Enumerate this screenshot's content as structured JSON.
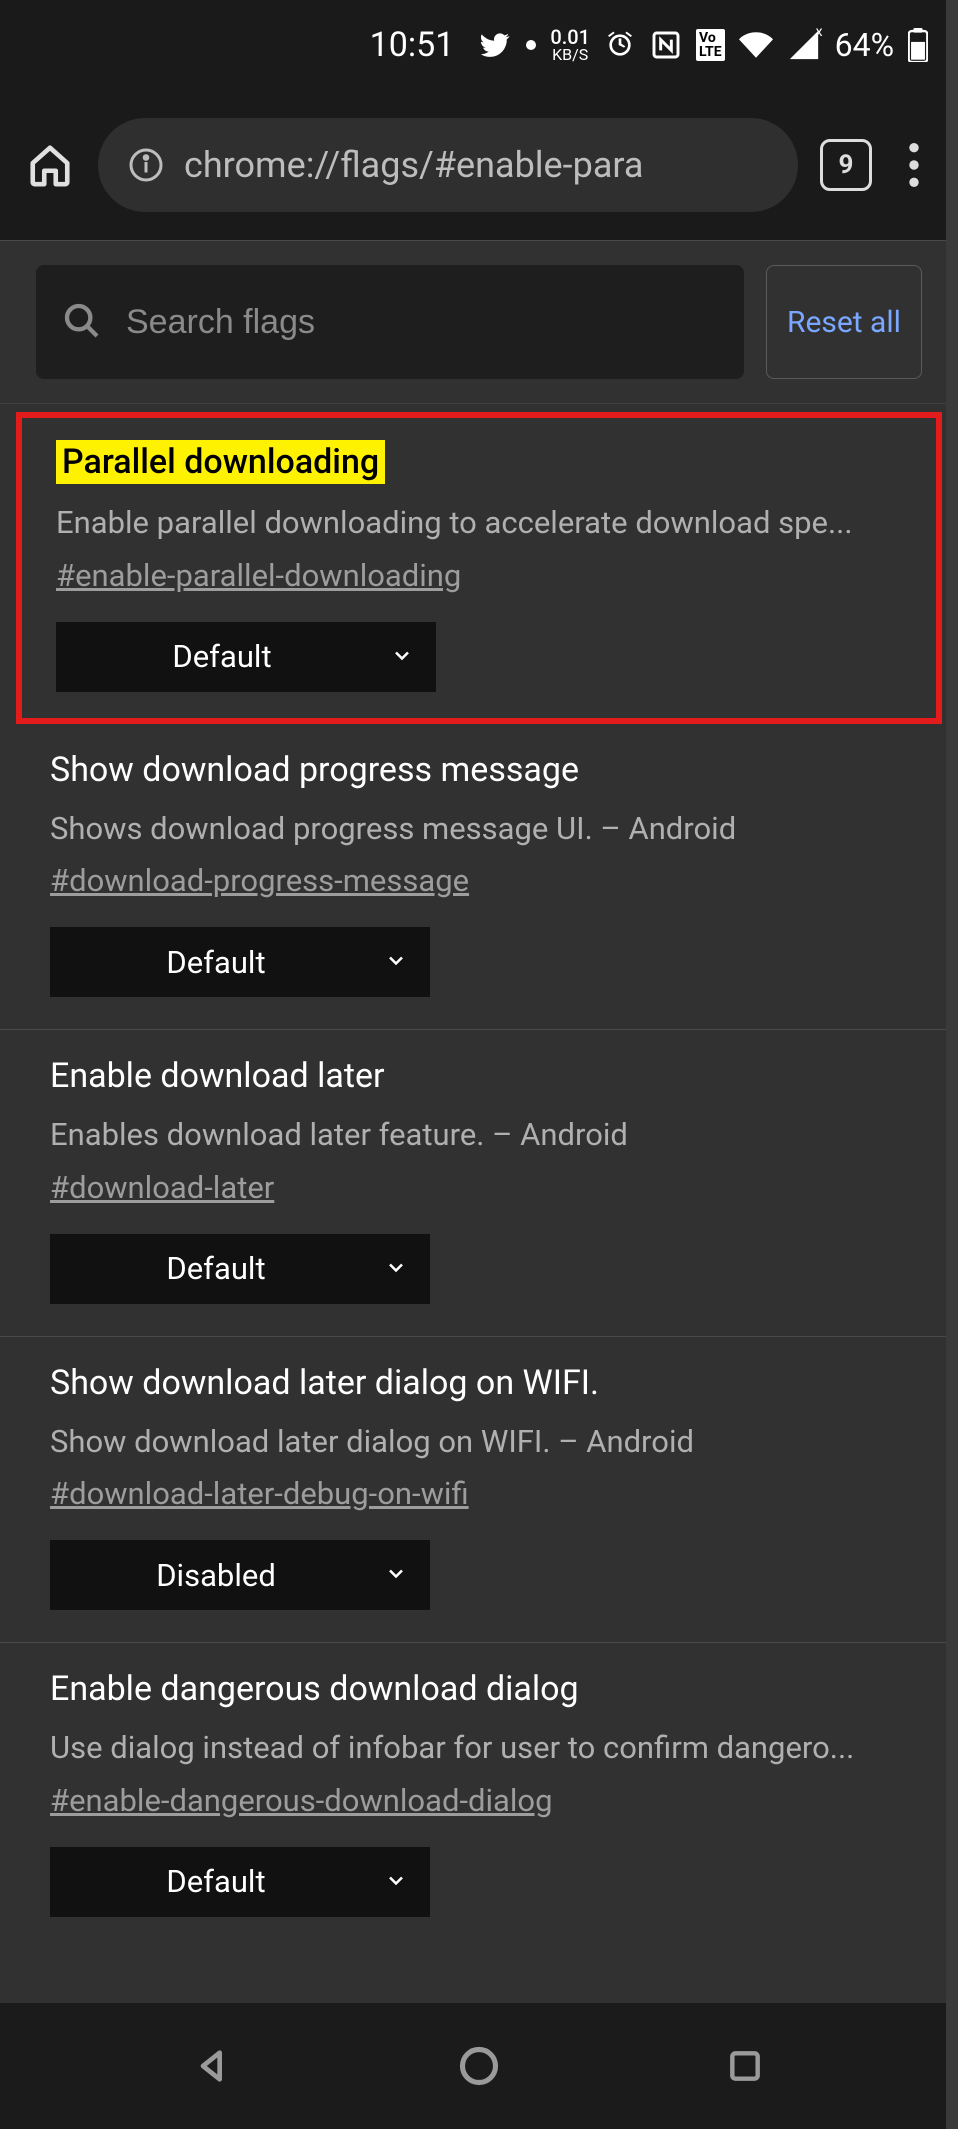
{
  "status": {
    "time": "10:51",
    "kbs_value": "0.01",
    "kbs_unit": "KB/S",
    "battery_pct": "64%"
  },
  "browser": {
    "url": "chrome://flags/#enable-para",
    "tab_count": "9"
  },
  "search": {
    "placeholder": "Search flags",
    "reset_label": "Reset all"
  },
  "flags": [
    {
      "title": "Parallel downloading",
      "desc": "Enable parallel downloading to accelerate download spe...",
      "anchor": "#enable-parallel-downloading",
      "value": "Default",
      "highlighted": true
    },
    {
      "title": "Show download progress message",
      "desc": "Shows download progress message UI. – Android",
      "anchor": "#download-progress-message",
      "value": "Default"
    },
    {
      "title": "Enable download later",
      "desc": "Enables download later feature. – Android",
      "anchor": "#download-later",
      "value": "Default"
    },
    {
      "title": "Show download later dialog on WIFI.",
      "desc": "Show download later dialog on WIFI. – Android",
      "anchor": "#download-later-debug-on-wifi",
      "value": "Disabled"
    },
    {
      "title": "Enable dangerous download dialog",
      "desc": "Use dialog instead of infobar for user to confirm dangero...",
      "anchor": "#enable-dangerous-download-dialog",
      "value": "Default"
    }
  ]
}
